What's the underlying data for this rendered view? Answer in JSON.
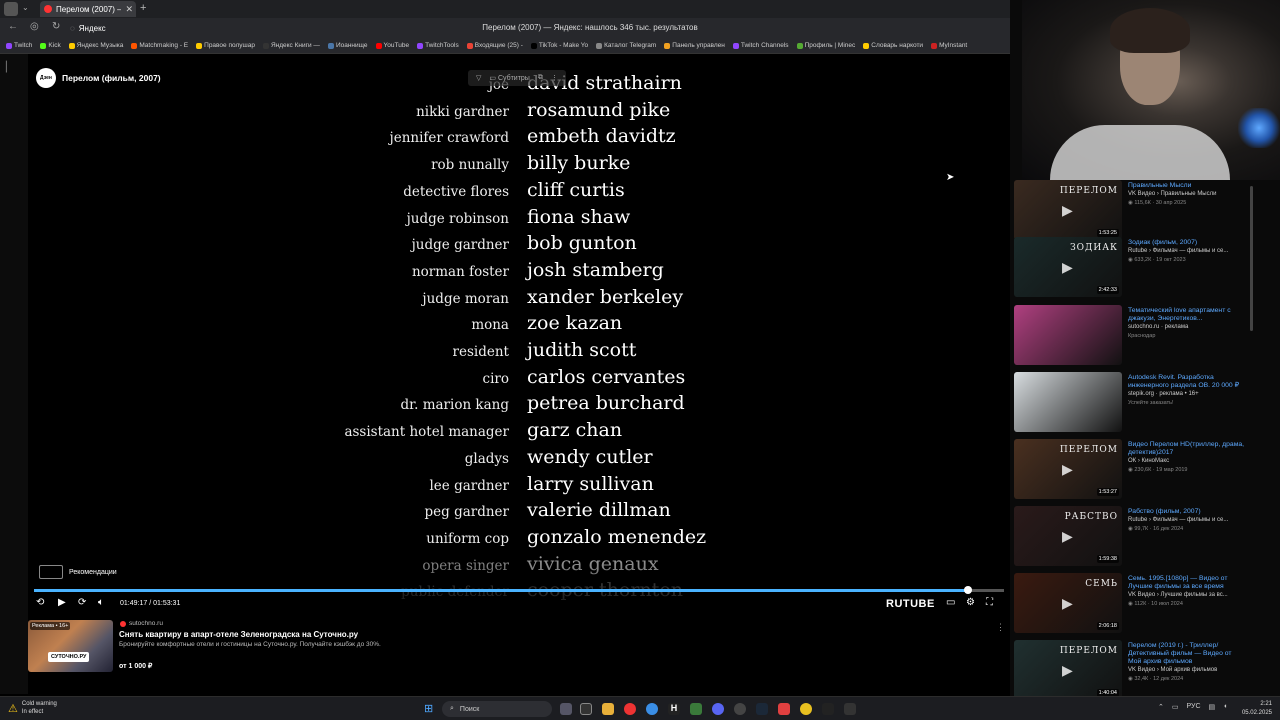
{
  "browser": {
    "tab_title": "Перелом (2007) — Я",
    "new_tab": "+",
    "address_text": "Яндекс",
    "page_title": "Перелом (2007) — Яндекс: нашлось 346 тыс. результатов",
    "bookmarks": [
      {
        "label": "Twitch",
        "color": "#9146ff"
      },
      {
        "label": "Kick",
        "color": "#53fc18"
      },
      {
        "label": "Яндекс Музыка",
        "color": "#ffcc00"
      },
      {
        "label": "Matchmaking - E",
        "color": "#ff5500"
      },
      {
        "label": "Правое полушар",
        "color": "#ffcc00"
      },
      {
        "label": "Яндекс Книги —",
        "color": "#333333"
      },
      {
        "label": "Иоаннище",
        "color": "#4a76a8"
      },
      {
        "label": "YouTube",
        "color": "#ff0000"
      },
      {
        "label": "TwitchTools",
        "color": "#9146ff"
      },
      {
        "label": "Входящие (25) -",
        "color": "#ea4335"
      },
      {
        "label": "TikTok - Make Yo",
        "color": "#000000"
      },
      {
        "label": "Каталог Telegram",
        "color": "#888888"
      },
      {
        "label": "Панель управлен",
        "color": "#f0a020"
      },
      {
        "label": "Twitch Channels",
        "color": "#9146ff"
      },
      {
        "label": "Профиль | Minec",
        "color": "#55aa33"
      },
      {
        "label": "Словарь наркоти",
        "color": "#ffcc00"
      },
      {
        "label": "MyInstant",
        "color": "#cc2222"
      }
    ]
  },
  "player": {
    "logo_text": "Дзен",
    "title": "Перелом (фильм, 2007)",
    "subtitles_label": "Субтитры",
    "credits": [
      {
        "role": "joe",
        "name": "david strathairn"
      },
      {
        "role": "nikki gardner",
        "name": "rosamund pike"
      },
      {
        "role": "jennifer crawford",
        "name": "embeth davidtz"
      },
      {
        "role": "rob nunally",
        "name": "billy burke"
      },
      {
        "role": "detective flores",
        "name": "cliff curtis"
      },
      {
        "role": "judge robinson",
        "name": "fiona shaw"
      },
      {
        "role": "judge gardner",
        "name": "bob gunton"
      },
      {
        "role": "norman foster",
        "name": "josh stamberg"
      },
      {
        "role": "judge moran",
        "name": "xander berkeley"
      },
      {
        "role": "mona",
        "name": "zoe kazan"
      },
      {
        "role": "resident",
        "name": "judith scott"
      },
      {
        "role": "ciro",
        "name": "carlos cervantes"
      },
      {
        "role": "dr. marion kang",
        "name": "petrea burchard"
      },
      {
        "role": "assistant hotel manager",
        "name": "garz chan"
      },
      {
        "role": "gladys",
        "name": "wendy cutler"
      },
      {
        "role": "lee gardner",
        "name": "larry sullivan"
      },
      {
        "role": "peg gardner",
        "name": "valerie dillman"
      },
      {
        "role": "uniform cop",
        "name": "gonzalo menendez"
      },
      {
        "role": "opera singer",
        "name": "vivica genaux"
      },
      {
        "role": "public defender",
        "name": "cooper thornton"
      }
    ],
    "recommendations_label": "Рекомендации",
    "time": "01:49:17 / 01:53:31",
    "progress": 0.963,
    "brand": "RUTUBE",
    "progress_color": "#4ab3ff"
  },
  "ad": {
    "age_label": "Реклама • 16+",
    "badge": "СУТОЧНО.РУ",
    "domain": "sutochno.ru",
    "title": "Снять квартиру в апарт-отеле Зеленоградска на Суточно.ру",
    "description": "Бронируйте комфортные отели и гостиницы на Суточно.ру. Получайте кэшбэк до 30%.",
    "price": "от 1 000 ₽"
  },
  "related_videos": [
    {
      "title": "Правильные Мысли",
      "source": "VK Видео › Правильные Мысли",
      "meta": "◉ 115,6К · 30 апр 2025",
      "duration": "1:53:25",
      "thumb": "#3a2a20",
      "thumb_text": "ПЕРЕЛОМ"
    },
    {
      "title": "Зодиак (фильм, 2007)",
      "source": "Rutube › Фильмач — фильмы и се...",
      "meta": "◉ 633,2К · 19 окт 2023",
      "duration": "2:42:33",
      "thumb": "#1a2a2a",
      "thumb_text": "ЗОДИАК"
    },
    {
      "title": "Тематический love апартамент с джакузи, Энергетиков...",
      "source": "sutochno.ru · реклама",
      "meta": "Краснодар",
      "duration": "",
      "thumb": "#b04080",
      "thumb_text": ""
    },
    {
      "title": "Autodesk Revit. Разработка инженерного раздела ОВ. 20 000 ₽",
      "source": "stepik.org · реклама • 16+",
      "meta": "Успейте заказать!",
      "duration": "",
      "thumb": "#d8dde0",
      "thumb_text": ""
    },
    {
      "title": "Видео Перелом HD(триллер, драма, детектив)2017",
      "source": "ОК › КиноМакс",
      "meta": "◉ 230,6К · 19 мар 2019",
      "duration": "1:53:27",
      "thumb": "#4a3020",
      "thumb_text": "ПЕРЕЛОМ"
    },
    {
      "title": "Рабство (фильм, 2007)",
      "source": "Rutube › Фильмач — фильмы и се...",
      "meta": "◉ 99,7К · 16 дек 2024",
      "duration": "1:59:38",
      "thumb": "#2a1a1a",
      "thumb_text": "РАБСТВО"
    },
    {
      "title": "Семь. 1995.[1080p] — Видео от Лучшие фильмы за все время",
      "source": "VK Видео › Лучшие фильмы за вс...",
      "meta": "◉ 112К · 10 июл 2024",
      "duration": "2:06:18",
      "thumb": "#3a1a10",
      "thumb_text": "СЕМЬ"
    },
    {
      "title": "Перелом (2019 г.) - Триллер/Детективный фильм — Видео от Мой архив фильмов",
      "source": "VK Видео › Мой архив фильмов",
      "meta": "◉ 32,4К · 12 дек 2024",
      "duration": "1:40:04",
      "thumb": "#203030",
      "thumb_text": "ПЕРЕЛОМ"
    }
  ],
  "taskbar": {
    "weather_title": "Cold warning",
    "weather_sub": "In effect",
    "search_label": "Поиск",
    "lang": "РУС",
    "time": "2:21",
    "date": "05.02.2025"
  }
}
